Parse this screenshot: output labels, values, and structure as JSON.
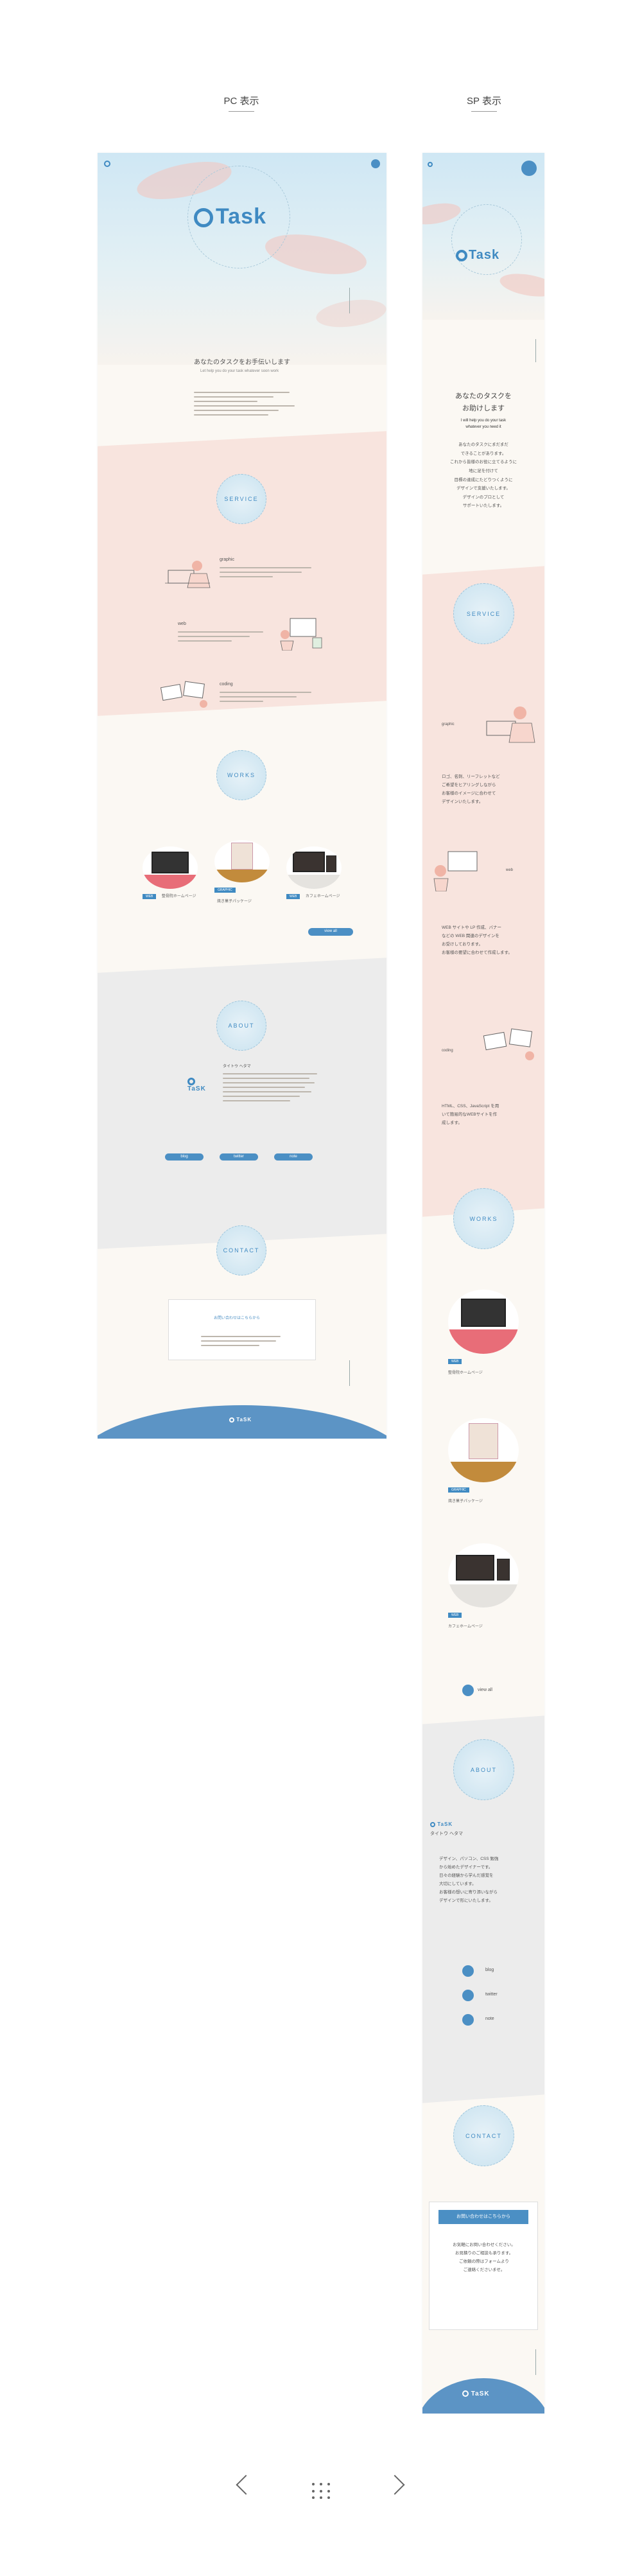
{
  "labels": {
    "pc": "PC 表示",
    "sp": "SP 表示"
  },
  "brand": {
    "logo": "Task",
    "logo_small": "TaSK"
  },
  "pc": {
    "intro_title": "あなたのタスクをお手伝いします",
    "intro_sub": "Let help you do your task whatever soon work",
    "sections": {
      "service": "SERVICE",
      "works": "WORKS",
      "about": "ABOUT",
      "contact": "CONTACT"
    },
    "services": [
      {
        "title": "graphic"
      },
      {
        "title": "web"
      },
      {
        "title": "coding"
      }
    ],
    "works": [
      {
        "tag": "WEB",
        "caption": "整骨院ホームページ"
      },
      {
        "tag": "GRAPHIC",
        "caption": "焼き菓子パッケージ"
      },
      {
        "tag": "WEB",
        "caption": "カフェホームページ"
      }
    ],
    "view_all": "view all",
    "about_name": "タイトウ ヘタマ",
    "links": [
      "blog",
      "twitter",
      "note"
    ],
    "contact_label": "お問い合わせはこちらから",
    "footer_logo": "TaSK"
  },
  "sp": {
    "intro_title_1": "あなたのタスクを",
    "intro_title_2": "お助けします",
    "intro_sub_1": "I will help you do your task",
    "intro_sub_2": "whatever you need it",
    "intro_body": [
      "あなたのタスクにまだまだ",
      "できることがあります。",
      "これから皆様のお役に立てるように",
      "地に足を付けて",
      "目標の達成にたどりつくように",
      "デザインで支援いたします。",
      "デザインのプロとして",
      "サポートいたします。"
    ],
    "sections": {
      "service": "SERVICE",
      "works": "WORKS",
      "about": "ABOUT",
      "contact": "CONTACT"
    },
    "services": [
      {
        "title": "graphic",
        "body": [
          "ロゴ、名刺、リーフレットなど",
          "ご希望をヒアリングしながら",
          "お客様のイメージに合わせて",
          "デザインいたします。"
        ]
      },
      {
        "title": "web",
        "body": [
          "WEB サイトや LP 作成、バナー",
          "などの WEB 関連のデザインを",
          "お受けしております。",
          "お客様の要望に合わせて作成します。"
        ]
      },
      {
        "title": "coding",
        "body": [
          "HTML、CSS、JavaScript を用",
          "いて簡易的なWEBサイトを作",
          "成します。"
        ]
      }
    ],
    "works": [
      {
        "tag": "WEB",
        "caption": "整骨院ホームページ"
      },
      {
        "tag": "GRAPHIC",
        "caption": "焼き菓子パッケージ"
      },
      {
        "tag": "WEB",
        "caption": "カフェホームページ"
      }
    ],
    "view_all": "view all",
    "about_name": "タイトウ ヘタマ",
    "about_body": [
      "デザイン、パソコン、CSS 勉強",
      "から始めたデザイナーです。",
      "日々の経験から学んだ感覚を",
      "大切にしています。",
      "お客様の想いに寄り添いながら",
      "デザインで形にいたします。"
    ],
    "links": [
      "blog",
      "twitter",
      "note"
    ],
    "contact_label": "お問い合わせはこちらから",
    "contact_body": [
      "お気軽にお問い合わせください。",
      "お見積りのご相談も承ります。",
      "ご依頼の際はフォームより",
      "ご連絡くださいませ。"
    ],
    "footer_logo": "TaSK"
  },
  "pager": {
    "prev_icon": "chevron-left",
    "grid_icon": "grid",
    "next_icon": "chevron-right"
  }
}
